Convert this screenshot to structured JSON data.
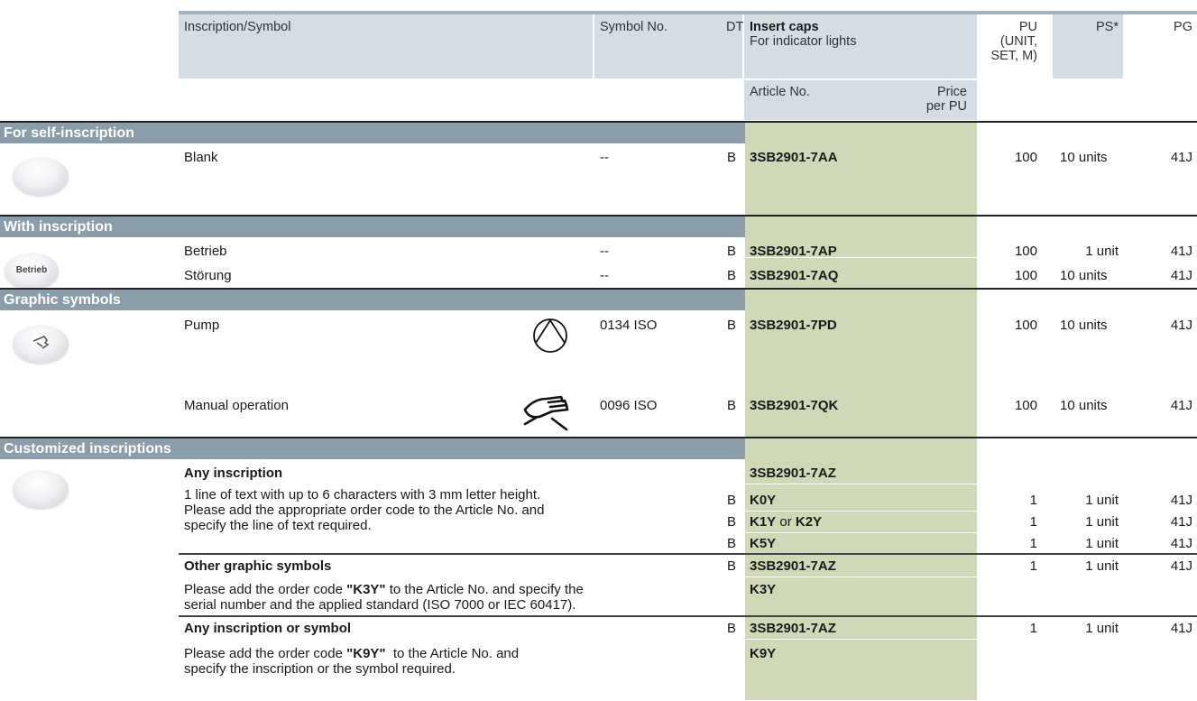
{
  "header": {
    "inscription": "Inscription/Symbol",
    "symbol_no": "Symbol No.",
    "dt": "DT",
    "insert_caps": "Insert caps",
    "for_indicator": "For indicator lights",
    "pu_1": "PU",
    "pu_2": "(UNIT,",
    "pu_3": "SET, M)",
    "ps": "PS*",
    "pg": "PG",
    "article_no": "Article No.",
    "price_1": "Price",
    "price_2": "per PU"
  },
  "sections": {
    "self": "For self-inscription",
    "with": "With inscription",
    "graphic": "Graphic symbols",
    "custom": "Customized inscriptions"
  },
  "cap_labels": {
    "betrieb": "Betrieb"
  },
  "rows": [
    {
      "desc": "Blank",
      "sym": "--",
      "dt": "B",
      "article": "3SB2901-7AA",
      "pu": "100",
      "ps": "10 units",
      "pg": "41J"
    },
    {
      "desc": "Betrieb",
      "sym": "--",
      "dt": "B",
      "article": "3SB2901-7AP",
      "pu": "100",
      "ps": "1 unit",
      "pg": "41J"
    },
    {
      "desc": "Störung",
      "sym": "--",
      "dt": "B",
      "article": "3SB2901-7AQ",
      "pu": "100",
      "ps": "10 units",
      "pg": "41J"
    },
    {
      "desc": "Pump",
      "sym": "0134 ISO",
      "dt": "B",
      "article": "3SB2901-7PD",
      "pu": "100",
      "ps": "10 units",
      "pg": "41J"
    },
    {
      "desc": "Manual operation",
      "sym": "0096 ISO",
      "dt": "B",
      "article": "3SB2901-7QK",
      "pu": "100",
      "ps": "10 units",
      "pg": "41J"
    }
  ],
  "custom": {
    "any_title": "Any inscription",
    "any_article": "3SB2901-7AZ",
    "any_text_1": "1 line of text with up to 6 characters with 3 mm letter height.",
    "any_text_2": "Please add the appropriate order code to the Article No. and",
    "any_text_3": "specify the line of text required.",
    "opts": [
      {
        "dt": "B",
        "code": "K0Y",
        "code_b": "",
        "or": "",
        "pu": "1",
        "ps": "1 unit",
        "pg": "41J"
      },
      {
        "dt": "B",
        "code": "K1Y",
        "or": " or ",
        "code_b": "K2Y",
        "pu": "1",
        "ps": "1 unit",
        "pg": "41J"
      },
      {
        "dt": "B",
        "code": "K5Y",
        "code_b": "",
        "or": "",
        "pu": "1",
        "ps": "1 unit",
        "pg": "41J"
      }
    ],
    "other_title": "Other graphic symbols",
    "other_dt": "B",
    "other_article": "3SB2901-7AZ",
    "other_pu": "1",
    "other_ps": "1 unit",
    "other_pg": "41J",
    "other_text_1a": "Please add the order code ",
    "other_text_1b": "\"K3Y\"",
    "other_text_1c": " to the Article No. and specify the",
    "other_text_2": "serial number and the applied standard (ISO 7000 or IEC 60417).",
    "other_code": "K3Y",
    "sym_title": "Any inscription or symbol",
    "sym_dt": "B",
    "sym_article": "3SB2901-7AZ",
    "sym_pu": "1",
    "sym_ps": "1 unit",
    "sym_pg": "41J",
    "sym_text_1a": "Please add the order code ",
    "sym_text_1b": "\"K9Y\"",
    "sym_text_1c": "  to the Article No. and",
    "sym_text_2": "specify the inscription or the symbol required.",
    "sym_code": "K9Y"
  }
}
